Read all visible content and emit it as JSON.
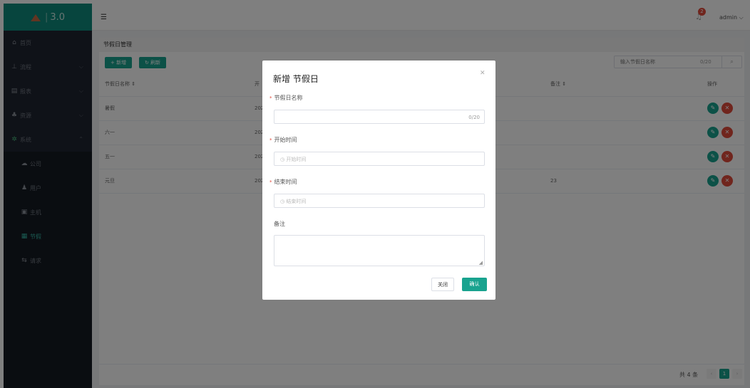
{
  "brand": {
    "version": "3.0"
  },
  "header": {
    "user": "admin ⌵",
    "badge_count": "2"
  },
  "sidebar": {
    "items": [
      {
        "label": "首页",
        "icon": "home-icon"
      },
      {
        "label": "流程",
        "icon": "flow-icon"
      },
      {
        "label": "报表",
        "icon": "report-icon"
      },
      {
        "label": "资源",
        "icon": "resource-icon"
      },
      {
        "label": "系统",
        "icon": "gear-icon"
      }
    ],
    "subitems": [
      {
        "label": "公司",
        "icon": "cloud-icon"
      },
      {
        "label": "用户",
        "icon": "user-icon"
      },
      {
        "label": "主机",
        "icon": "host-icon"
      },
      {
        "label": "节假",
        "icon": "calendar-icon"
      },
      {
        "label": "请求",
        "icon": "request-icon"
      }
    ]
  },
  "panel": {
    "title": "节假日管理",
    "add_label": "+ 新增",
    "refresh_label": "↻ 刷新",
    "search_placeholder": "输入节假日名称",
    "search_count": "0/20"
  },
  "table": {
    "headers": {
      "name": "节假日名称 ⇕",
      "start": "开",
      "note": "备注 ⇕",
      "op": "操作"
    },
    "rows": [
      {
        "name": "暑假",
        "start": "202",
        "note": ""
      },
      {
        "name": "六一",
        "start": "202",
        "note": ""
      },
      {
        "name": "五一",
        "start": "202",
        "note": ""
      },
      {
        "name": "元旦",
        "start": "202",
        "note": "23"
      }
    ]
  },
  "pager": {
    "total": "共 4 条",
    "current": "1"
  },
  "modal": {
    "title": "新增 节假日",
    "name_label": "节假日名称",
    "name_count": "0/20",
    "start_label": "开始时间",
    "start_placeholder": "开始时间",
    "end_label": "结束时间",
    "end_placeholder": "结束时间",
    "note_label": "备注",
    "close_label": "关闭",
    "ok_label": "确认"
  },
  "colors": {
    "accent": "#19a38f",
    "danger": "#e14a3b",
    "sidebar": "#1f2430"
  }
}
